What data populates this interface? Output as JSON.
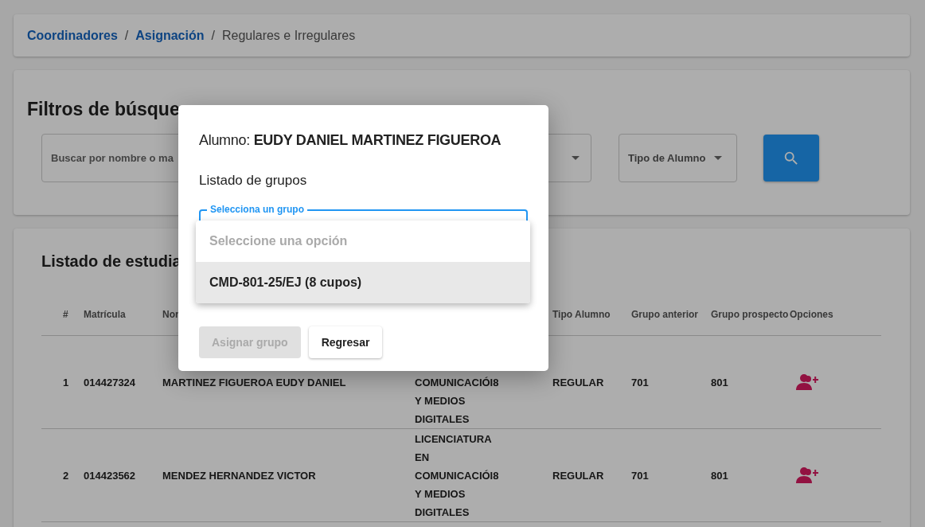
{
  "breadcrumb": {
    "separator": "/",
    "items": [
      {
        "label": "Coordinadores",
        "kind": "link"
      },
      {
        "label": "Asignación",
        "kind": "link"
      },
      {
        "label": "Regulares e Irregulares",
        "kind": "current"
      }
    ]
  },
  "filters": {
    "title": "Filtros de búsque",
    "search": {
      "placeholder": "Buscar por nombre o ma"
    },
    "tipo_select": {
      "label": "Tipo de Alumno"
    }
  },
  "students": {
    "title": "Listado de estudia",
    "columns": {
      "number": "#",
      "matricula": "Matrícula",
      "nombre": "Nor",
      "tipo": "Tipo Alumno",
      "grupo_anterior": "Grupo anterior",
      "grupo_prospecto": "Grupo prospecto",
      "opciones": "Opciones"
    },
    "rows": [
      {
        "number": "1",
        "matricula": "014427324",
        "nombre": "MARTINEZ FIGUEROA EUDY DANIEL",
        "carrera": "COMUNICACIÓI8 Y MEDIOS DIGITALES",
        "tipo": "REGULAR",
        "grupo_anterior": "701",
        "grupo_prospecto": "801"
      },
      {
        "number": "2",
        "matricula": "014423562",
        "nombre": "MENDEZ HERNANDEZ VICTOR",
        "carrera": "LICENCIATURA EN COMUNICACIÓI8 Y MEDIOS DIGITALES",
        "tipo": "REGULAR",
        "grupo_anterior": "701",
        "grupo_prospecto": "801"
      }
    ]
  },
  "dialog": {
    "title": "Alumno: **EUDY DANIEL MARTINEZ FIGUEROA**",
    "subtitle": "Listado de grupos",
    "select": {
      "label": "Selecciona un grupo",
      "expanded": true,
      "options": [
        {
          "label": "Seleccione una opción",
          "kind": "placeholder",
          "highlighted": false
        },
        {
          "label": "CMD-801-25/EJ (8 cupos)",
          "kind": "option",
          "highlighted": true
        }
      ]
    },
    "buttons": [
      {
        "label": "Asignar grupo",
        "disabled": true
      },
      {
        "label": "Regresar",
        "disabled": false
      }
    ]
  }
}
